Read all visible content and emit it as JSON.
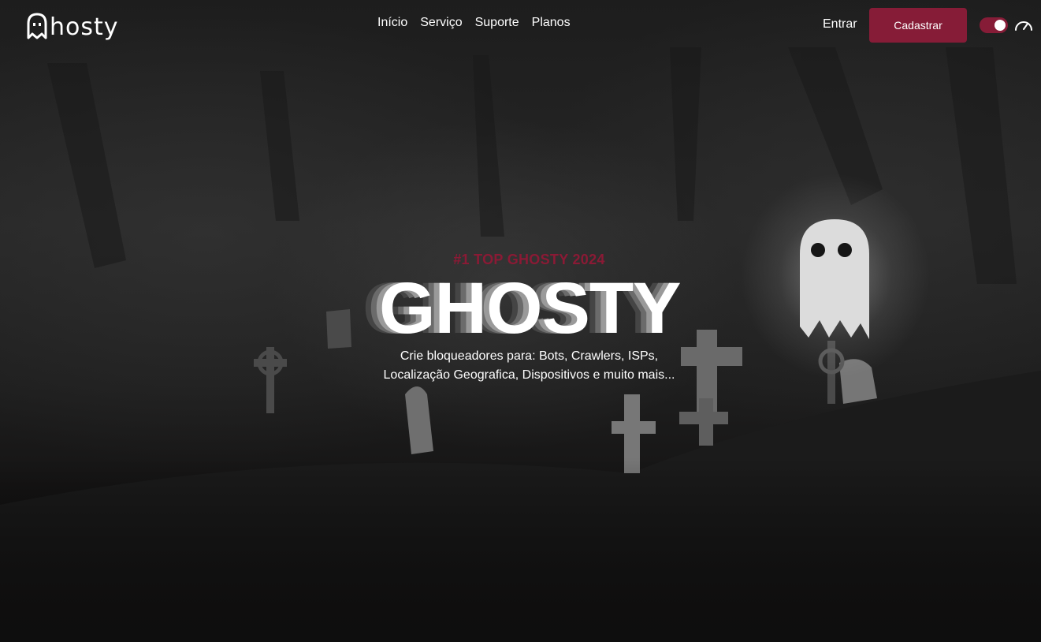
{
  "brand": {
    "logo_text": "hosty"
  },
  "nav": {
    "items": [
      {
        "label": "Início"
      },
      {
        "label": "Serviço"
      },
      {
        "label": "Suporte"
      },
      {
        "label": "Planos"
      }
    ]
  },
  "header": {
    "login_label": "Entrar",
    "signup_label": "Cadastrar"
  },
  "theme_toggle": {
    "state": "on"
  },
  "hero": {
    "eyebrow": "#1 TOP GHOSTY 2024",
    "title": "GHOSTY",
    "subtitle_line1": "Crie bloqueadores para: Bots, Crawlers, ISPs,",
    "subtitle_line2": "Localização Geografica, Dispositivos e muito mais..."
  },
  "colors": {
    "accent": "#861c37",
    "eyebrow": "#8a1a35",
    "background": "#1e1e1e"
  }
}
